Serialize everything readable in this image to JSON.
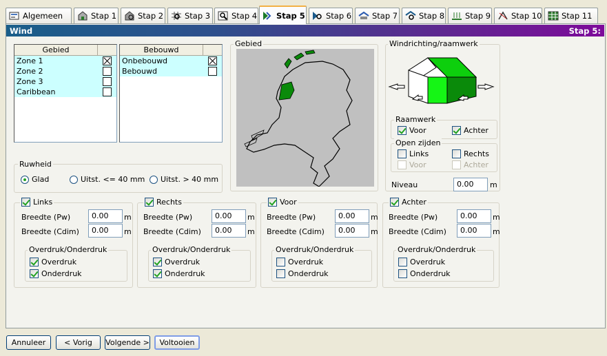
{
  "tabs": [
    {
      "label": "Algemeen",
      "icon": "general-settings-icon"
    },
    {
      "label": "Stap 1",
      "icon": "building-icon"
    },
    {
      "label": "Stap 2",
      "icon": "building-search-icon"
    },
    {
      "label": "Stap 3",
      "icon": "grid-search-icon"
    },
    {
      "label": "Stap 4",
      "icon": "magnifier-icon"
    },
    {
      "label": "Stap 5",
      "icon": "wind-icon"
    },
    {
      "label": "Stap 6",
      "icon": "wind-search-icon"
    },
    {
      "label": "Stap 7",
      "icon": "roof-icon"
    },
    {
      "label": "Stap 8",
      "icon": "roof-search-icon"
    },
    {
      "label": "Stap 9",
      "icon": "load-arrows-icon"
    },
    {
      "label": "Stap 10",
      "icon": "compass-icon"
    },
    {
      "label": "Stap 11",
      "icon": "table-icon"
    }
  ],
  "header": {
    "title": "Wind",
    "step": "Stap 5:"
  },
  "gebied_list": {
    "header": "Gebied",
    "rows": [
      {
        "label": "Zone 1",
        "checked": true
      },
      {
        "label": "Zone 2",
        "checked": false
      },
      {
        "label": "Zone 3",
        "checked": false
      },
      {
        "label": "Caribbean",
        "checked": false
      }
    ]
  },
  "bebouwd_list": {
    "header": "Bebouwd",
    "rows": [
      {
        "label": "Onbebouwd",
        "checked": true
      },
      {
        "label": "Bebouwd",
        "checked": false
      }
    ]
  },
  "map": {
    "title": "Gebied"
  },
  "wind": {
    "title": "Windrichting/raamwerk",
    "raamwerk": {
      "title": "Raamwerk",
      "voor": "Voor",
      "achter": "Achter"
    },
    "open": {
      "title": "Open zijden",
      "links": "Links",
      "rechts": "Rechts",
      "voor": "Voor",
      "achter": "Achter"
    },
    "niveau": {
      "label": "Niveau",
      "value": "0.00",
      "unit": "m"
    }
  },
  "ruwheid": {
    "title": "Ruwheid",
    "options": [
      "Glad",
      "Uitst. <= 40 mm",
      "Uitst. > 40 mm"
    ],
    "selected": "Glad"
  },
  "sides": [
    {
      "name": "Links",
      "checked": true,
      "pw": "0.00",
      "cdim": "0.00",
      "over": true,
      "onder": true
    },
    {
      "name": "Rechts",
      "checked": true,
      "pw": "0.00",
      "cdim": "0.00",
      "over": true,
      "onder": true
    },
    {
      "name": "Voor",
      "checked": true,
      "pw": "0.00",
      "cdim": "0.00",
      "over": false,
      "onder": false
    },
    {
      "name": "Achter",
      "checked": true,
      "pw": "0.00",
      "cdim": "0.00",
      "over": false,
      "onder": false
    }
  ],
  "side_labels": {
    "pw": "Breedte (Pw)",
    "cdim": "Breedte (Cdim)",
    "unit": "m",
    "group": "Overdruk/Onderdruk",
    "over": "Overdruk",
    "onder": "Onderdruk"
  },
  "buttons": {
    "cancel": "Annuleer",
    "prev": "< Vorig",
    "next": "Volgende >",
    "finish": "Voltooien"
  },
  "colors": {
    "accent_green": "#0aa30a",
    "list_bg": "#ccffff",
    "header_start": "#1a5e8a",
    "header_end": "#7d0a9a"
  }
}
